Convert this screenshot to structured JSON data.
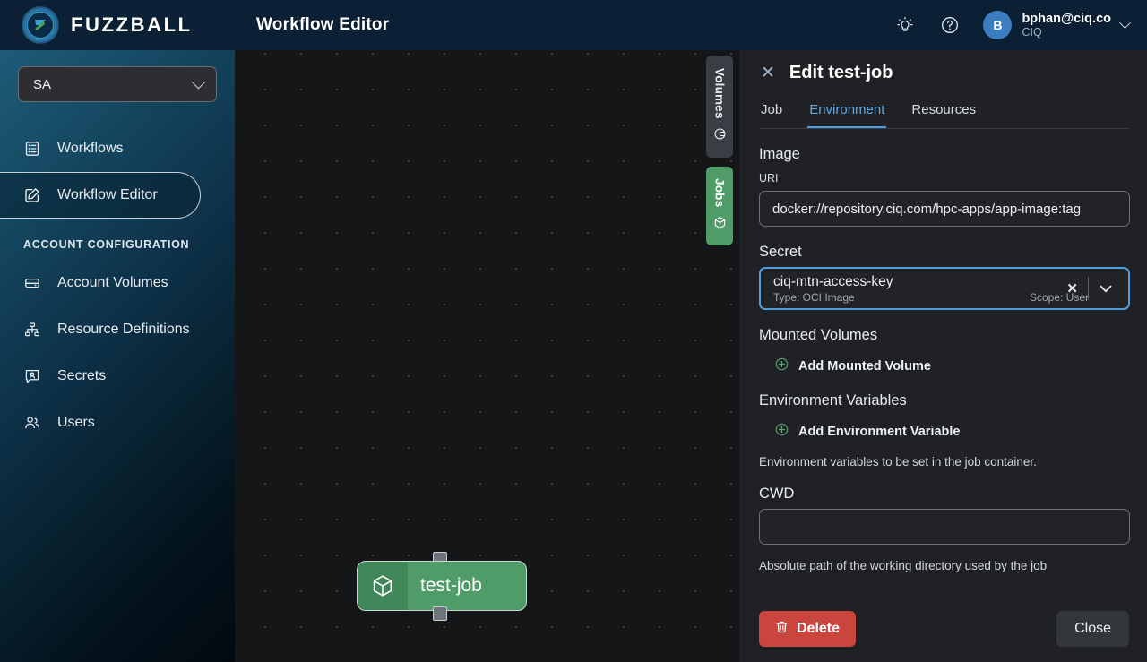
{
  "brand": {
    "name": "FUZZBALL",
    "logo_icon": "fuzzball-logo-icon"
  },
  "sidebar": {
    "account_select": {
      "value": "SA",
      "chevron_icon": "chevron-down-icon"
    },
    "items": [
      {
        "label": "Workflows",
        "icon": "list-document-icon",
        "active": false
      },
      {
        "label": "Workflow Editor",
        "icon": "edit-square-icon",
        "active": true
      }
    ],
    "section_label": "ACCOUNT CONFIGURATION",
    "config_items": [
      {
        "label": "Account Volumes",
        "icon": "drive-icon"
      },
      {
        "label": "Resource Definitions",
        "icon": "hierarchy-icon"
      },
      {
        "label": "Secrets",
        "icon": "secret-badge-icon"
      },
      {
        "label": "Users",
        "icon": "users-icon"
      }
    ]
  },
  "topbar": {
    "title": "Workflow Editor",
    "theme_icon": "lightbulb-icon",
    "help_icon": "question-circle-icon",
    "user": {
      "initial": "B",
      "email": "bphan@ciq.co",
      "org": "CIQ",
      "chevron_icon": "chevron-down-icon"
    }
  },
  "canvas": {
    "side_tabs": [
      {
        "label": "Volumes",
        "icon": "volume-database-icon",
        "active": false
      },
      {
        "label": "Jobs",
        "icon": "cube-icon",
        "active": true
      }
    ],
    "node": {
      "label": "test-job",
      "icon": "cube-icon",
      "selected": true
    }
  },
  "panel": {
    "close_icon": "close-icon",
    "title": "Edit test-job",
    "tabs": [
      {
        "label": "Job",
        "active": false
      },
      {
        "label": "Environment",
        "active": true
      },
      {
        "label": "Resources",
        "active": false
      }
    ],
    "image": {
      "heading": "Image",
      "uri_label": "URI",
      "uri_value": "docker://repository.ciq.com/hpc-apps/app-image:tag",
      "uri_placeholder": ""
    },
    "secret": {
      "heading": "Secret",
      "value": "ciq-mtn-access-key",
      "type_text": "Type: OCI Image",
      "scope_text": "Scope: User",
      "clear_icon": "close-icon",
      "chevron_icon": "chevron-down-icon"
    },
    "mounted_volumes": {
      "heading": "Mounted Volumes",
      "add_label": "Add Mounted Volume",
      "add_icon": "plus-circle-icon"
    },
    "environment_variables": {
      "heading": "Environment Variables",
      "add_label": "Add Environment Variable",
      "add_icon": "plus-circle-icon",
      "helper": "Environment variables to be set in the job container."
    },
    "cwd": {
      "label": "CWD",
      "value": "",
      "placeholder": "",
      "helper": "Absolute path of the working directory used by the job"
    },
    "buttons": {
      "delete_label": "Delete",
      "delete_icon": "trash-icon",
      "close_label": "Close"
    }
  },
  "colors": {
    "accent_blue": "#4d9de0",
    "node_green": "#4f9c69",
    "danger_red": "#c9453d",
    "brand_navy": "#0b2034"
  }
}
